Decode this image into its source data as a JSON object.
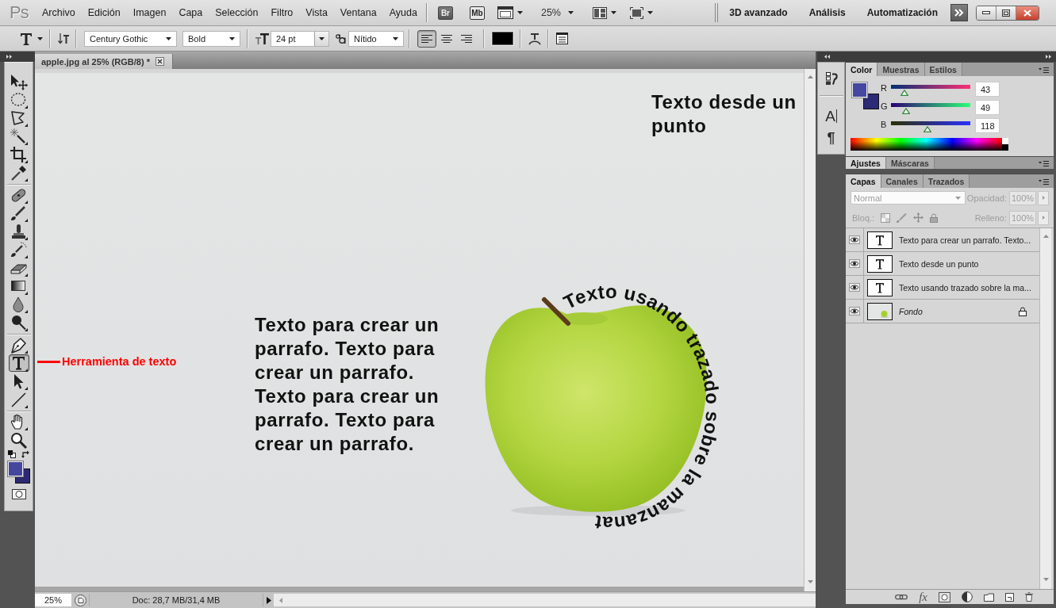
{
  "menu_bar": {
    "logo": "Ps",
    "items": [
      "Archivo",
      "Edición",
      "Imagen",
      "Capa",
      "Selección",
      "Filtro",
      "Vista",
      "Ventana",
      "Ayuda"
    ],
    "bridge": "Br",
    "mini_bridge": "Mb",
    "zoom": "25%",
    "workspaces": [
      "3D avanzado",
      "Análisis",
      "Automatización"
    ]
  },
  "options_bar": {
    "font_family": "Century Gothic",
    "font_style": "Bold",
    "font_size": "24 pt",
    "antialias": "Nítido",
    "alignment": [
      {
        "kind": "left",
        "selected": true
      },
      {
        "kind": "center",
        "selected": false
      },
      {
        "kind": "right",
        "selected": false
      }
    ]
  },
  "tool_groups": [
    [
      {
        "kind": "move",
        "selected": false
      },
      {
        "kind": "marquee",
        "selected": false
      },
      {
        "kind": "lasso",
        "selected": false
      },
      {
        "kind": "wand",
        "selected": false
      },
      {
        "kind": "crop",
        "selected": false
      },
      {
        "kind": "eyedropper",
        "selected": false
      }
    ],
    [
      {
        "kind": "healing",
        "selected": false
      },
      {
        "kind": "brush",
        "selected": false
      },
      {
        "kind": "stamp",
        "selected": false
      },
      {
        "kind": "history_brush",
        "selected": false
      },
      {
        "kind": "eraser",
        "selected": false
      },
      {
        "kind": "gradient",
        "selected": false
      },
      {
        "kind": "blur",
        "selected": false
      },
      {
        "kind": "dodge",
        "selected": false
      }
    ],
    [
      {
        "kind": "pen",
        "selected": false
      },
      {
        "kind": "type",
        "selected": true
      },
      {
        "kind": "path_select",
        "selected": false
      },
      {
        "kind": "line",
        "selected": false
      }
    ],
    [
      {
        "kind": "hand",
        "selected": false
      },
      {
        "kind": "zoom",
        "selected": false
      }
    ]
  ],
  "document": {
    "tab": "apple.jpg al 25% (RGB/8) *",
    "point_text": [
      "Texto desde un",
      "punto"
    ],
    "paragraph_text": [
      "Texto para crear un",
      "parrafo. Texto para",
      "crear un parrafo.",
      "Texto para crear un",
      "parrafo. Texto para",
      "crear un parrafo."
    ],
    "path_text": "Texto usando trazado sobre la manzanat"
  },
  "annotation": {
    "label": "Herramienta de texto"
  },
  "status_bar": {
    "zoom": "25%",
    "doc_info": "Doc: 28,7 MB/31,4 MB"
  },
  "dock": [
    {
      "kind": "history"
    },
    {
      "kind": "character",
      "label": "A"
    },
    {
      "kind": "paragraph",
      "label": "¶"
    }
  ],
  "color_panel": {
    "tabs": [
      {
        "label": "Color",
        "selected": true
      },
      {
        "label": "Muestras",
        "selected": false
      },
      {
        "label": "Estilos",
        "selected": false
      }
    ],
    "channels": [
      {
        "label": "R",
        "value": "43",
        "level": 0.17
      },
      {
        "label": "G",
        "value": "49",
        "level": 0.19
      },
      {
        "label": "B",
        "value": "118",
        "level": 0.46
      }
    ]
  },
  "adjustments_panel": {
    "tabs": [
      {
        "label": "Ajustes",
        "selected": true
      },
      {
        "label": "Máscaras",
        "selected": false
      }
    ]
  },
  "layers_panel": {
    "tabs": [
      {
        "label": "Capas",
        "selected": true
      },
      {
        "label": "Canales",
        "selected": false
      },
      {
        "label": "Trazados",
        "selected": false
      }
    ],
    "blend_mode": {
      "value": "Normal",
      "disabled": true
    },
    "opacity": {
      "label": "Opacidad:",
      "value": "100%",
      "disabled": true
    },
    "lock": {
      "label": "Bloq.:",
      "disabled": true
    },
    "fill": {
      "label": "Relleno:",
      "value": "100%",
      "disabled": true
    },
    "layers": [
      {
        "kind": "text",
        "name": "Texto para crear un parrafo. Texto...",
        "visible": true,
        "locked": false
      },
      {
        "kind": "text",
        "name": "Texto desde un punto",
        "visible": true,
        "locked": false
      },
      {
        "kind": "text",
        "name": "Texto usando trazado sobre la ma...",
        "visible": true,
        "locked": false
      },
      {
        "kind": "background",
        "name": "Fondo",
        "visible": true,
        "locked": true
      }
    ],
    "effects_label": "fx"
  }
}
